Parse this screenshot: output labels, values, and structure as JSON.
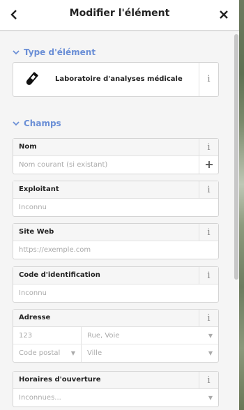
{
  "header": {
    "title": "Modifier l'élément",
    "back_icon": "‹",
    "close_icon": "✕"
  },
  "type_section": {
    "title": "Type d'élément",
    "preset_label": "Laboratoire d'analyses médicale",
    "info": "i"
  },
  "fields_section": {
    "title": "Champs",
    "fields": {
      "name": {
        "label": "Nom",
        "placeholder": "Nom courant (si existant)"
      },
      "operator": {
        "label": "Exploitant",
        "placeholder": "Inconnu"
      },
      "website": {
        "label": "Site Web",
        "placeholder": "https://exemple.com"
      },
      "ref": {
        "label": "Code d'identification",
        "placeholder": "Inconnu"
      },
      "address": {
        "label": "Adresse",
        "housenumber": "123",
        "street": "Rue, Voie",
        "postcode": "Code postal",
        "city": "Ville"
      },
      "opening_hours": {
        "label": "Horaires d'ouverture",
        "placeholder": "Inconnues..."
      }
    }
  },
  "colors": {
    "accent": "#6b8fd6"
  }
}
